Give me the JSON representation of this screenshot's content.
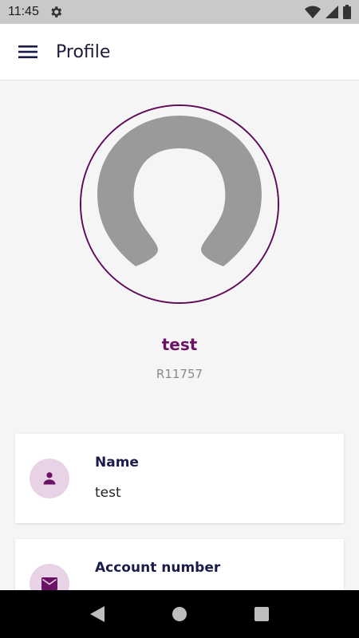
{
  "status_bar": {
    "time": "11:45",
    "icons": [
      "settings-gear-icon",
      "wifi-icon",
      "cell-signal-icon",
      "battery-icon"
    ]
  },
  "app_bar": {
    "menu_icon": "hamburger-menu-icon",
    "title": "Profile"
  },
  "profile": {
    "avatar_icon": "default-user-silhouette",
    "name": "test",
    "id": "R11757"
  },
  "cards": {
    "name": {
      "icon": "person-icon",
      "label": "Name",
      "value": "test"
    },
    "account": {
      "icon": "envelope-icon",
      "label": "Account number"
    }
  },
  "nav_bar": {
    "icons": [
      "back-triangle-icon",
      "home-circle-icon",
      "recents-square-icon"
    ]
  },
  "colors": {
    "accent": "#6a1364",
    "ring": "#5f0b5a",
    "icon_bg": "#e8d3e6",
    "heading": "#1c1c4c",
    "status_bar": "#c9c9c9"
  }
}
